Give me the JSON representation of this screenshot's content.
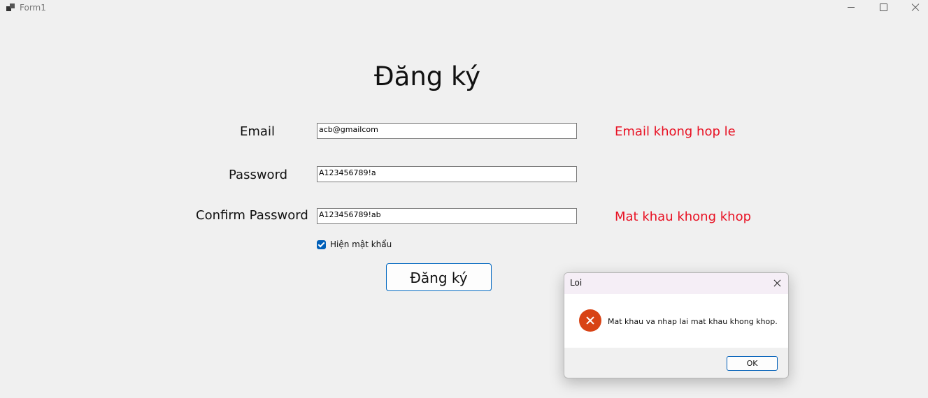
{
  "window": {
    "title": "Form1",
    "controls": {
      "minimize_icon": "minimize-icon",
      "maximize_icon": "maximize-icon",
      "close_icon": "close-icon"
    }
  },
  "form": {
    "heading": "Đăng ký",
    "fields": [
      {
        "label": "Email",
        "value": "acb@gmailcom",
        "error": "Email khong hop le"
      },
      {
        "label": "Password",
        "value": "A123456789!a",
        "error": ""
      },
      {
        "label": "Confirm Password",
        "value": "A123456789!ab",
        "error": "Mat khau khong khop"
      }
    ],
    "show_password": {
      "label": "Hiện mật khẩu",
      "checked": true
    },
    "submit_label": "Đăng ký"
  },
  "dialog": {
    "title": "Loi",
    "icon": "error-icon",
    "message": "Mat khau va nhap lai mat khau khong khop.",
    "ok_label": "OK"
  },
  "colors": {
    "error_text": "#e81123",
    "accent": "#005fb8",
    "error_icon": "#d84315",
    "background": "#f0f0f0"
  }
}
